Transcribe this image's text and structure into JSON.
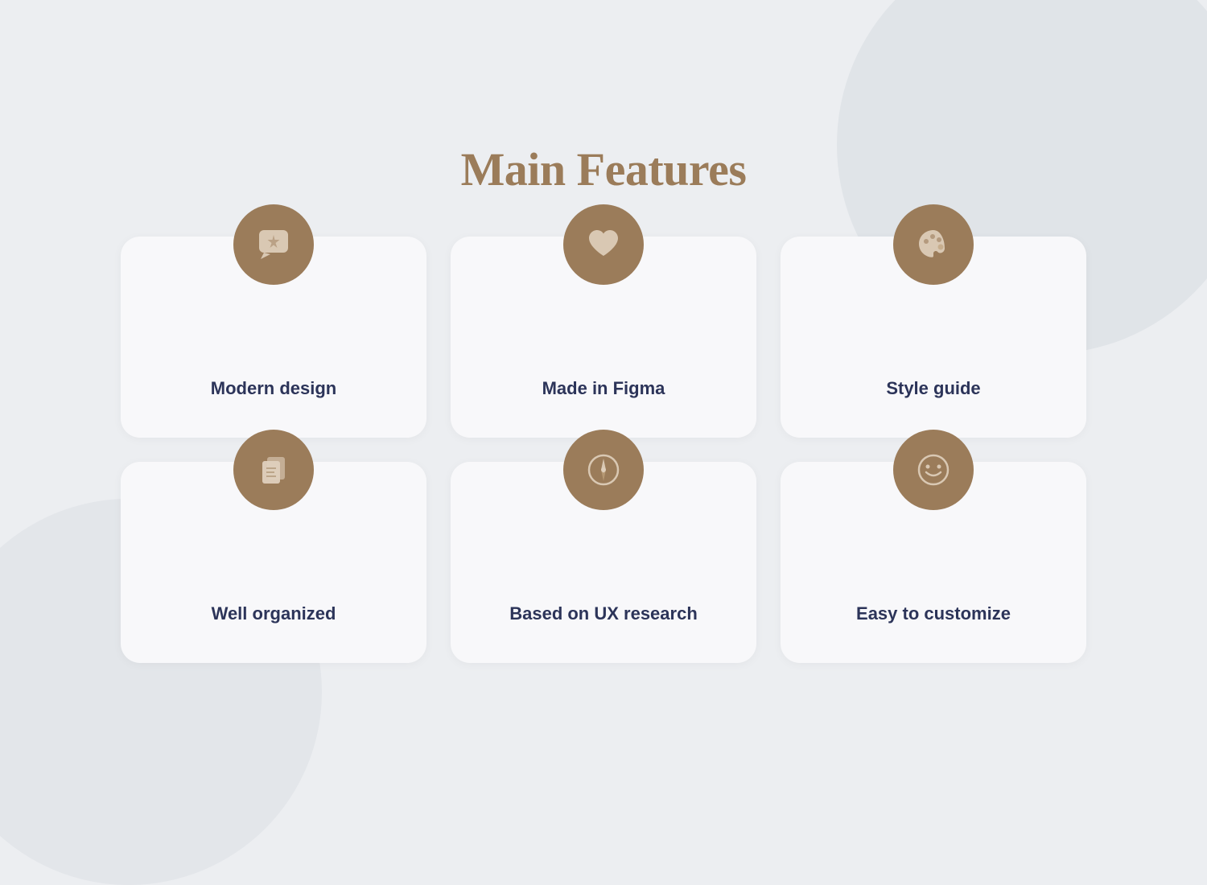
{
  "page": {
    "title": "Main Features",
    "background_color": "#eceef1",
    "accent_color": "#9b7c5a"
  },
  "features": [
    {
      "id": "modern-design",
      "label": "Modern design",
      "icon": "sparkle-chat"
    },
    {
      "id": "made-in-figma",
      "label": "Made in Figma",
      "icon": "heart"
    },
    {
      "id": "style-guide",
      "label": "Style guide",
      "icon": "palette"
    },
    {
      "id": "well-organized",
      "label": "Well organized",
      "icon": "documents"
    },
    {
      "id": "ux-research",
      "label": "Based  on UX research",
      "icon": "compass"
    },
    {
      "id": "easy-customize",
      "label": "Easy to customize",
      "icon": "smiley"
    }
  ]
}
